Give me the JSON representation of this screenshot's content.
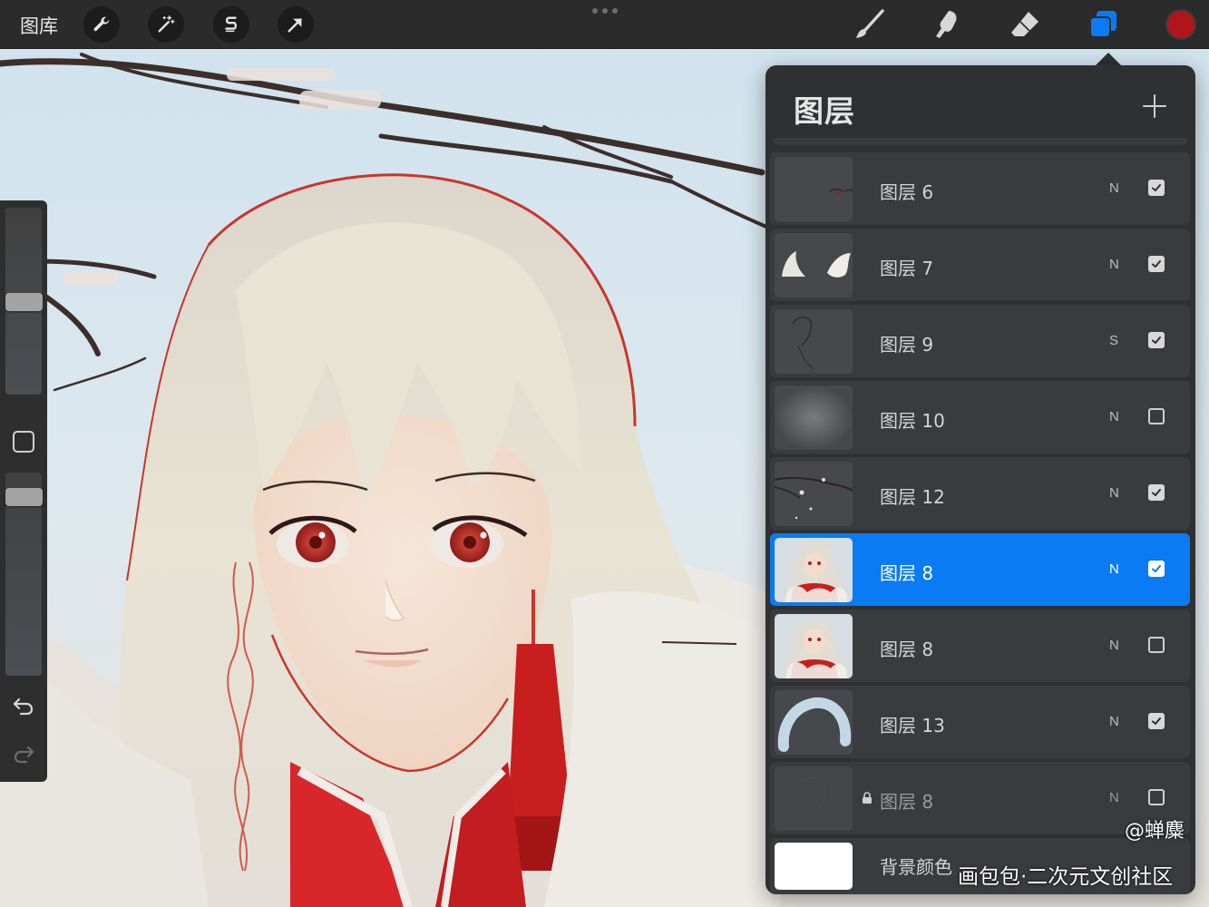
{
  "toolbar": {
    "gallery_label": "图库",
    "left_tools": [
      "wrench-icon",
      "magic-wand-icon",
      "selection-s-icon",
      "transform-arrow-icon"
    ],
    "right_tools": [
      "brush-icon",
      "smudge-icon",
      "eraser-icon",
      "layers-icon"
    ],
    "active_tool": "layers-icon",
    "current_color": "#b0151b"
  },
  "panel": {
    "title": "图层",
    "layers": [
      {
        "name": "图层 6",
        "blend": "N",
        "visible": true,
        "selected": false,
        "locked": false,
        "thumb": "eyes-sketch"
      },
      {
        "name": "图层 7",
        "blend": "N",
        "visible": true,
        "selected": false,
        "locked": false,
        "thumb": "white-shapes"
      },
      {
        "name": "图层 9",
        "blend": "S",
        "visible": true,
        "selected": false,
        "locked": false,
        "thumb": "dark-sketch"
      },
      {
        "name": "图层 10",
        "blend": "N",
        "visible": false,
        "selected": false,
        "locked": false,
        "thumb": "soft-glow"
      },
      {
        "name": "图层 12",
        "blend": "N",
        "visible": true,
        "selected": false,
        "locked": false,
        "thumb": "branches"
      },
      {
        "name": "图层 8",
        "blend": "N",
        "visible": true,
        "selected": true,
        "locked": false,
        "thumb": "portrait"
      },
      {
        "name": "图层 8",
        "blend": "N",
        "visible": false,
        "selected": false,
        "locked": false,
        "thumb": "portrait"
      },
      {
        "name": "图层 13",
        "blend": "N",
        "visible": true,
        "selected": false,
        "locked": false,
        "thumb": "fur-arc"
      },
      {
        "name": "图层 8",
        "blend": "N",
        "visible": false,
        "selected": false,
        "locked": true,
        "thumb": "faint-sketch"
      },
      {
        "name": "背景颜色",
        "blend": "",
        "visible": true,
        "selected": false,
        "locked": false,
        "thumb": "white"
      }
    ]
  },
  "watermark": {
    "author": "@蝉麋",
    "site": "画包包·二次元文创社区"
  },
  "colors": {
    "accent": "#0a7bf2",
    "panel_bg": "#2f3032",
    "row_bg": "#3a3b3e",
    "toolbar_bg": "#2b2b2b"
  }
}
